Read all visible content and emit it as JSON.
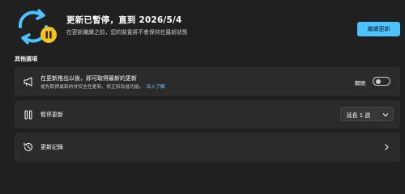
{
  "header": {
    "title": "更新已暫停，直到 2026/5/4",
    "subtitle": "在更新繼續之前，您的裝置將不會保持在最新狀態",
    "resume_label": "繼續更新"
  },
  "more_options": {
    "section_label": "其他選項",
    "latest_updates": {
      "title": "在更新推出以後，即可取得最新的更新",
      "description": "搶先取得最新的非安全性更新、修正和改進功能。",
      "learn_more": "深入了解",
      "toggle_state": "關閉"
    },
    "pause_updates": {
      "title": "暫停更新",
      "duration_selected": "延長 1 週"
    },
    "update_history": {
      "title": "更新記錄"
    }
  },
  "colors": {
    "accent": "#4cc2ff",
    "pause_badge": "#f6c21c",
    "background": "#202020",
    "card": "#2b2b2b"
  }
}
